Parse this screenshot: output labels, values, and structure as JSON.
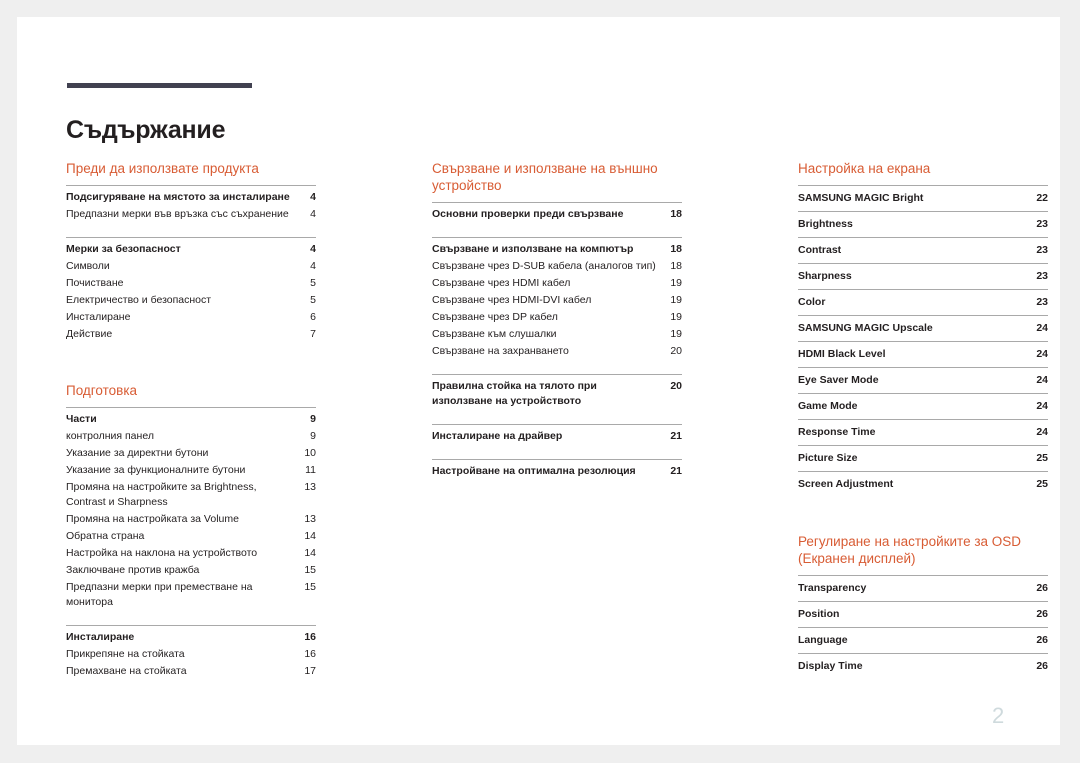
{
  "document": {
    "title": "Съдържание",
    "page_number": "2",
    "accent_color": "#d85c34",
    "rule_color": "#414150",
    "folio_color": "#cfdadd"
  },
  "columns": {
    "left": {
      "sections": [
        {
          "heading": "Преди да използвате продукта",
          "groups": [
            {
              "entries": [
                {
                  "label": "Подсигуряване на мястото за инсталиране",
                  "page": "4",
                  "bold": true
                },
                {
                  "label": "Предпазни мерки във връзка със съхранение",
                  "page": "4",
                  "bold": false
                }
              ]
            },
            {
              "entries": [
                {
                  "label": "Мерки за безопасност",
                  "page": "4",
                  "bold": true
                },
                {
                  "label": "Символи",
                  "page": "4",
                  "bold": false
                },
                {
                  "label": "Почистване",
                  "page": "5",
                  "bold": false
                },
                {
                  "label": "Електричество и безопасност",
                  "page": "5",
                  "bold": false
                },
                {
                  "label": "Инсталиране",
                  "page": "6",
                  "bold": false
                },
                {
                  "label": "Действие",
                  "page": "7",
                  "bold": false
                }
              ]
            }
          ]
        },
        {
          "heading": "Подготовка",
          "groups": [
            {
              "entries": [
                {
                  "label": "Части",
                  "page": "9",
                  "bold": true
                },
                {
                  "label": "контролния панел",
                  "page": "9",
                  "bold": false
                },
                {
                  "label": "Указание за директни бутони",
                  "page": "10",
                  "bold": false
                },
                {
                  "label": "Указание за функционалните бутони",
                  "page": "11",
                  "bold": false
                },
                {
                  "label": "Промяна на настройките за Brightness, Contrast и Sharpness",
                  "page": "13",
                  "bold": false
                },
                {
                  "label": "Промяна на настройката за Volume",
                  "page": "13",
                  "bold": false
                },
                {
                  "label": "Обратна страна",
                  "page": "14",
                  "bold": false
                },
                {
                  "label": "Настройка на наклона на устройството",
                  "page": "14",
                  "bold": false
                },
                {
                  "label": "Заключване против кражба",
                  "page": "15",
                  "bold": false
                },
                {
                  "label": "Предпазни мерки при преместване на монитора",
                  "page": "15",
                  "bold": false
                }
              ]
            },
            {
              "entries": [
                {
                  "label": "Инсталиране",
                  "page": "16",
                  "bold": true
                },
                {
                  "label": "Прикрепяне на стойката",
                  "page": "16",
                  "bold": false
                },
                {
                  "label": "Премахване на стойката",
                  "page": "17",
                  "bold": false
                }
              ]
            }
          ]
        }
      ]
    },
    "middle": {
      "sections": [
        {
          "heading": "Свързване и използване на външно устройство",
          "groups": [
            {
              "entries": [
                {
                  "label": "Основни проверки преди свързване",
                  "page": "18",
                  "bold": true
                }
              ]
            },
            {
              "entries": [
                {
                  "label": "Свързване и използване на компютър",
                  "page": "18",
                  "bold": true
                },
                {
                  "label": "Свързване чрез D-SUB кабела (аналогов тип)",
                  "page": "18",
                  "bold": false
                },
                {
                  "label": "Свързване чрез HDMI кабел",
                  "page": "19",
                  "bold": false
                },
                {
                  "label": "Свързване чрез HDMI-DVI кабел",
                  "page": "19",
                  "bold": false
                },
                {
                  "label": "Свързване чрез DP кабел",
                  "page": "19",
                  "bold": false
                },
                {
                  "label": "Свързване към слушалки",
                  "page": "19",
                  "bold": false
                },
                {
                  "label": "Свързване на захранването",
                  "page": "20",
                  "bold": false
                }
              ]
            },
            {
              "entries": [
                {
                  "label": "Правилна стойка на тялото при използване на устройството",
                  "page": "20",
                  "bold": true
                }
              ]
            },
            {
              "entries": [
                {
                  "label": "Инсталиране на драйвер",
                  "page": "21",
                  "bold": true
                }
              ]
            },
            {
              "entries": [
                {
                  "label": "Настройване на оптимална резолюция",
                  "page": "21",
                  "bold": true
                }
              ]
            }
          ]
        }
      ]
    },
    "right": {
      "sections": [
        {
          "heading": "Настройка на екрана",
          "rows": [
            {
              "label": "SAMSUNG MAGIC Bright",
              "page": "22"
            },
            {
              "label": "Brightness",
              "page": "23"
            },
            {
              "label": "Contrast",
              "page": "23"
            },
            {
              "label": "Sharpness",
              "page": "23"
            },
            {
              "label": "Color",
              "page": "23"
            },
            {
              "label": "SAMSUNG MAGIC Upscale",
              "page": "24"
            },
            {
              "label": "HDMI Black Level",
              "page": "24"
            },
            {
              "label": "Eye Saver Mode",
              "page": "24"
            },
            {
              "label": "Game Mode",
              "page": "24"
            },
            {
              "label": "Response Time",
              "page": "24"
            },
            {
              "label": "Picture Size",
              "page": "25"
            },
            {
              "label": "Screen Adjustment",
              "page": "25"
            }
          ]
        },
        {
          "heading": "Регулиране на настройките за OSD (Екранен дисплей)",
          "rows": [
            {
              "label": "Transparency",
              "page": "26"
            },
            {
              "label": "Position",
              "page": "26"
            },
            {
              "label": "Language",
              "page": "26"
            },
            {
              "label": "Display Time",
              "page": "26"
            }
          ]
        }
      ]
    }
  }
}
